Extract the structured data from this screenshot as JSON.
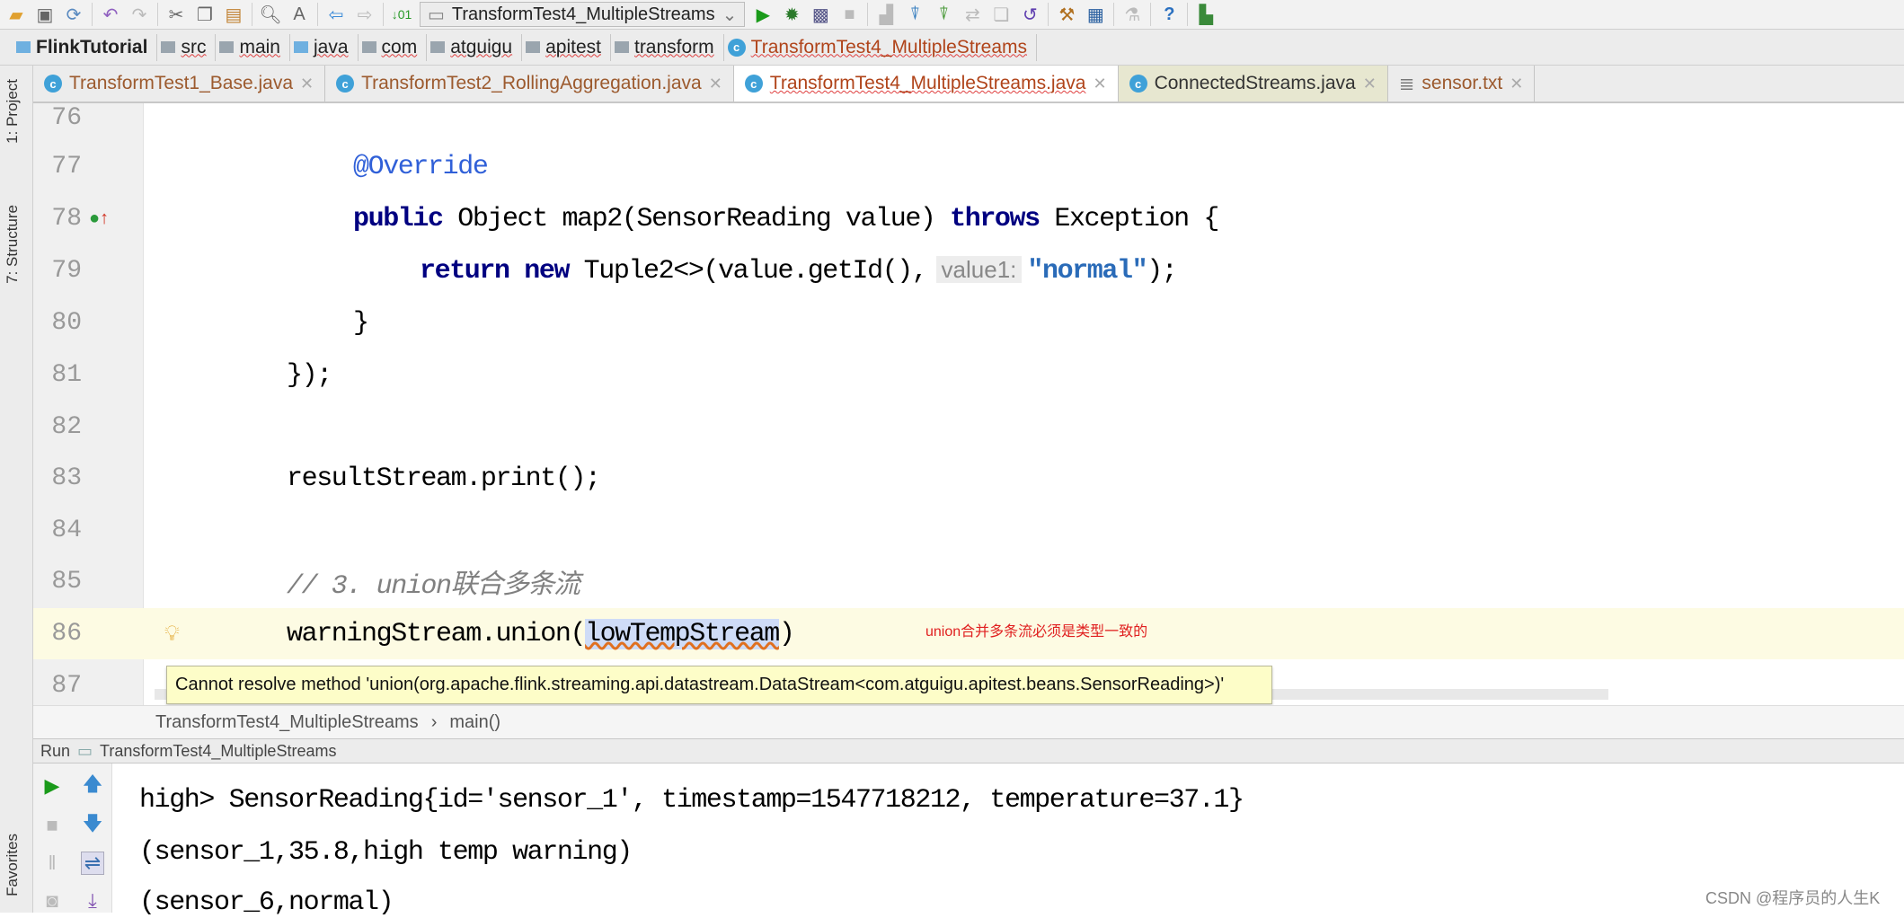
{
  "toolbar": {
    "run_config": "TransformTest4_MultipleStreams",
    "icons": [
      "open-folder-icon",
      "save-icon",
      "sync-icon",
      "undo-icon",
      "redo-icon",
      "cut-icon",
      "copy-icon",
      "paste-icon",
      "find-icon",
      "replace-icon",
      "back-icon",
      "forward-icon",
      "build-icon",
      "run-icon",
      "debug-icon",
      "coverage-icon",
      "stop-icon",
      "help-icon"
    ]
  },
  "breadcrumbs": [
    "FlinkTutorial",
    "src",
    "main",
    "java",
    "com",
    "atguigu",
    "apitest",
    "transform",
    "TransformTest4_MultipleStreams"
  ],
  "side": {
    "project": "1: Project",
    "structure": "7: Structure",
    "favorites": "Favorites"
  },
  "tabs": [
    "TransformTest1_Base.java",
    "TransformTest2_RollingAggregation.java",
    "TransformTest4_MultipleStreams.java",
    "ConnectedStreams.java",
    "sensor.txt"
  ],
  "editor": {
    "line_numbers": [
      "76",
      "77",
      "78",
      "79",
      "80",
      "81",
      "82",
      "83",
      "84",
      "85",
      "86",
      "87"
    ],
    "l77": "@Override",
    "l78": {
      "kw1": "public",
      "t1": " Object map2(SensorReading value) ",
      "kw2": "throws",
      "t2": " Exception {"
    },
    "l79": {
      "kw1": "return",
      "kw2": "new",
      "t1": " Tuple2<>(value.getId(),",
      "hint": "value1:",
      "str": "\"normal\"",
      "t2": ");"
    },
    "l80": "}",
    "l81": "});",
    "l83": "resultStream.print();",
    "l85": "// 3. union联合多条流",
    "l86": {
      "t1": "warningStream.union(",
      "sel": "lowTempStream",
      "t2": ")"
    },
    "annotation": "union合并多条流必须是类型一致的",
    "tooltip": "Cannot resolve method 'union(org.apache.flink.streaming.api.datastream.DataStream<com.atguigu.apitest.beans.SensorReading>)'"
  },
  "navbar": {
    "class": "TransformTest4_MultipleStreams",
    "method": "main()"
  },
  "run": {
    "label": "Run",
    "config": "TransformTest4_MultipleStreams",
    "lines": [
      "high> SensorReading{id='sensor_1', timestamp=1547718212, temperature=37.1}",
      "(sensor_1,35.8,high temp warning)",
      "(sensor_6,normal)"
    ]
  },
  "watermark": "CSDN @程序员的人生K"
}
